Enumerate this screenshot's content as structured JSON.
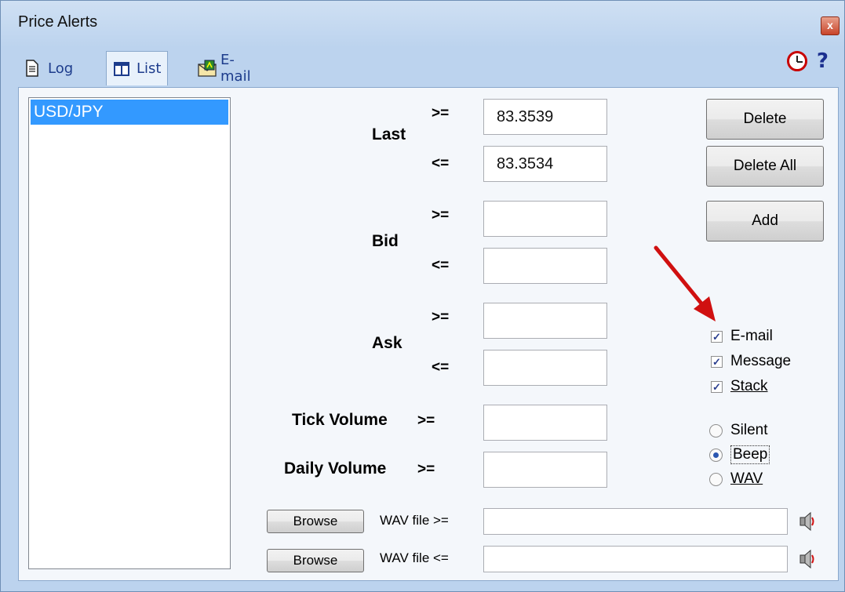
{
  "window": {
    "title": "Price Alerts",
    "close_glyph": "x"
  },
  "tabs": [
    {
      "label": "Log",
      "icon": "document-icon"
    },
    {
      "label": "List",
      "icon": "columns-icon"
    },
    {
      "label": "E-mail",
      "icon": "email-icon"
    }
  ],
  "toolbar": {
    "help_glyph": "?"
  },
  "symbols": [
    "USD/JPY"
  ],
  "alerts": {
    "last_label": "Last",
    "bid_label": "Bid",
    "ask_label": "Ask",
    "tick_volume_label": "Tick Volume",
    "daily_volume_label": "Daily Volume",
    "ge": ">=",
    "le": "<=",
    "last_ge_value": "83.3539",
    "last_le_value": "83.3534",
    "bid_ge_value": "",
    "bid_le_value": "",
    "ask_ge_value": "",
    "ask_le_value": "",
    "tick_volume_value": "",
    "daily_volume_value": ""
  },
  "buttons": {
    "delete": "Delete",
    "delete_all": "Delete All",
    "add": "Add",
    "browse": "Browse"
  },
  "notify": {
    "email": "E-mail",
    "email_checked": true,
    "message": "Message",
    "message_checked": true,
    "stack": "Stack",
    "stack_checked": true,
    "check_glyph": "✓"
  },
  "sound": {
    "silent": "Silent",
    "beep": "Beep",
    "wav": "WAV",
    "selected": "Beep"
  },
  "wav": {
    "ge_label": "WAV file  >=",
    "le_label": "WAV file  <=",
    "ge_value": "",
    "le_value": ""
  },
  "colors": {
    "selection": "#3399ff",
    "arrow": "#d01010"
  }
}
